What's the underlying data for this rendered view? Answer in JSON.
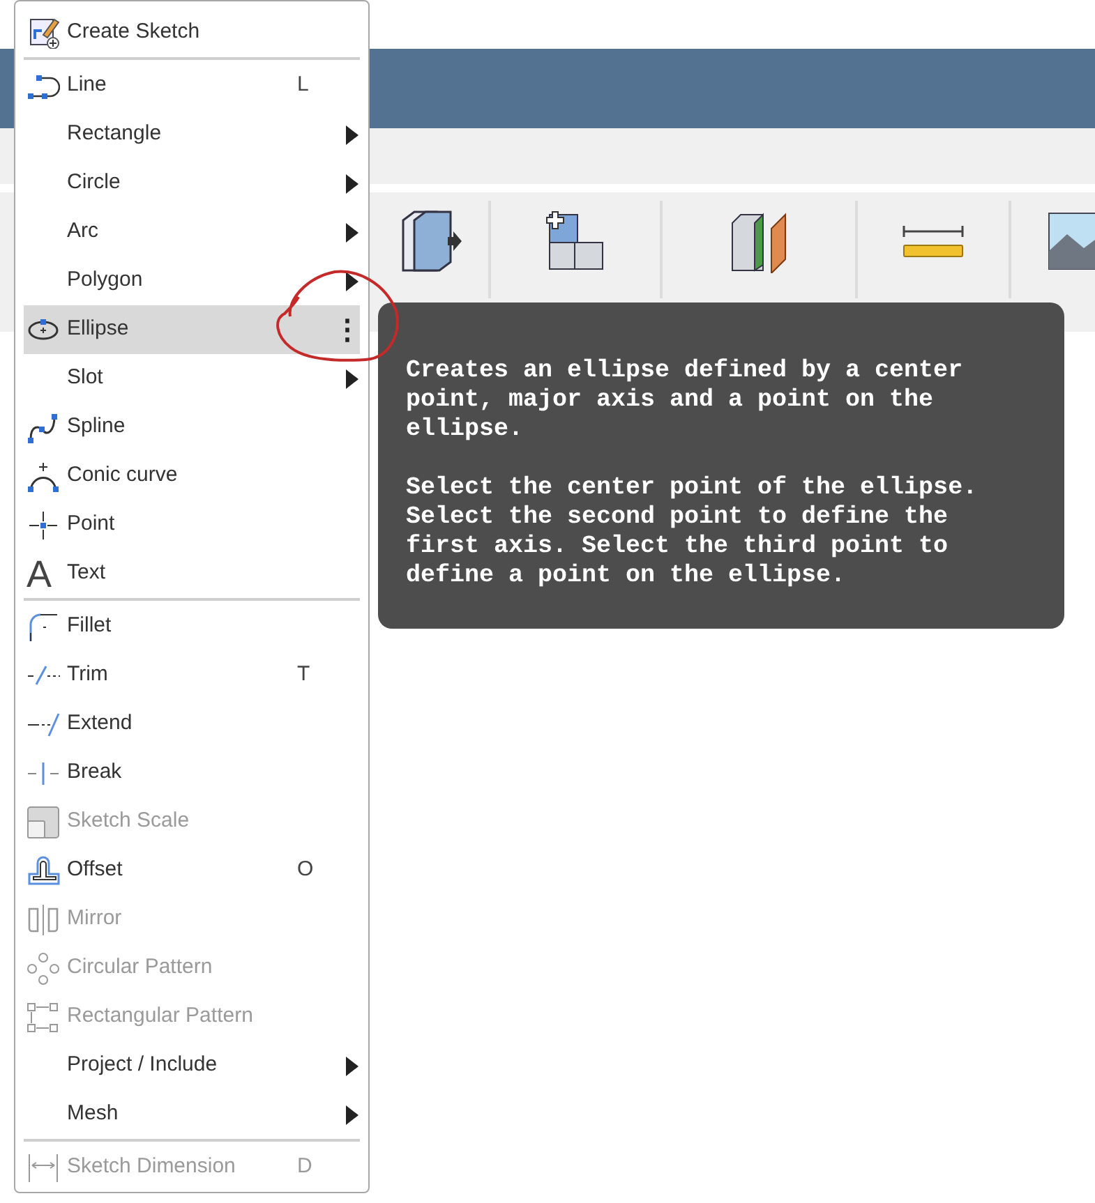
{
  "menu": {
    "groups": [
      [
        {
          "label": "Create Sketch",
          "submenu": false,
          "disabled": false,
          "selected": false
        }
      ],
      [
        {
          "label": "Line",
          "shortcut": "L",
          "submenu": false,
          "disabled": false,
          "selected": false
        },
        {
          "label": "Rectangle",
          "submenu": true,
          "disabled": false,
          "selected": false
        },
        {
          "label": "Circle",
          "submenu": true,
          "disabled": false,
          "selected": false
        },
        {
          "label": "Arc",
          "submenu": true,
          "disabled": false,
          "selected": false
        },
        {
          "label": "Polygon",
          "submenu": true,
          "disabled": false,
          "selected": false
        },
        {
          "label": "Ellipse",
          "submenu": false,
          "options": "⋮",
          "disabled": false,
          "selected": true
        },
        {
          "label": "Slot",
          "submenu": true,
          "disabled": false,
          "selected": false
        },
        {
          "label": "Spline",
          "submenu": false,
          "disabled": false,
          "selected": false
        },
        {
          "label": "Conic curve",
          "submenu": false,
          "disabled": false,
          "selected": false
        },
        {
          "label": "Point",
          "submenu": false,
          "disabled": false,
          "selected": false
        },
        {
          "label": "Text",
          "glyph": "A",
          "submenu": false,
          "disabled": false,
          "selected": false
        }
      ],
      [
        {
          "label": "Fillet",
          "submenu": false,
          "disabled": false,
          "selected": false
        },
        {
          "label": "Trim",
          "shortcut": "T",
          "submenu": false,
          "disabled": false,
          "selected": false
        },
        {
          "label": "Extend",
          "submenu": false,
          "disabled": false,
          "selected": false
        },
        {
          "label": "Break",
          "submenu": false,
          "disabled": false,
          "selected": false
        },
        {
          "label": "Sketch Scale",
          "submenu": false,
          "disabled": true,
          "selected": false
        },
        {
          "label": "Offset",
          "shortcut": "O",
          "submenu": false,
          "disabled": false,
          "selected": false
        },
        {
          "label": "Mirror",
          "submenu": false,
          "disabled": true,
          "selected": false
        },
        {
          "label": "Circular Pattern",
          "submenu": false,
          "disabled": true,
          "selected": false
        },
        {
          "label": "Rectangular Pattern",
          "submenu": false,
          "disabled": true,
          "selected": false
        },
        {
          "label": "Project / Include",
          "submenu": true,
          "disabled": false,
          "selected": false
        },
        {
          "label": "Mesh",
          "submenu": true,
          "disabled": false,
          "selected": false
        }
      ],
      [
        {
          "label": "Sketch Dimension",
          "shortcut": "D",
          "submenu": false,
          "disabled": true,
          "selected": false
        }
      ]
    ]
  },
  "tooltip": {
    "paragraphs": [
      "Creates an ellipse defined by a center point, major axis and a point on the ellipse.",
      "Select the center point of the ellipse. Select the second point to define the first axis. Select the third point to define a point on the ellipse."
    ]
  }
}
